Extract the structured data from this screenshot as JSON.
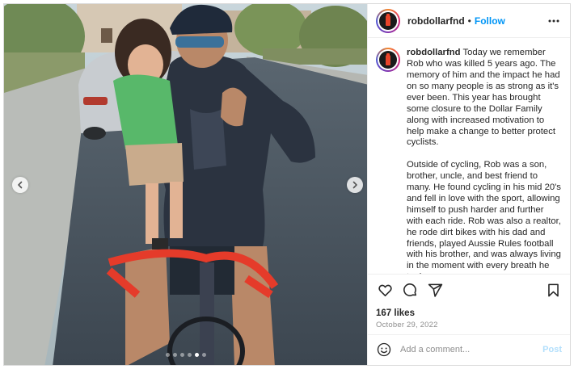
{
  "post": {
    "photo": {
      "slide_count": 6,
      "active_slide_index": 4
    },
    "header": {
      "username": "robdollarfnd",
      "separator": "•",
      "follow_label": "Follow",
      "more_icon": "more-horizontal-icon"
    },
    "caption": {
      "username": "robdollarfnd",
      "paragraph_1": "Today we remember Rob who was killed 5 years ago. The memory of him and the impact he had on so many people is as strong as it's ever been. This year has brought some closure to the Dollar Family along with increased motivation to help make a change to better protect cyclists.",
      "paragraph_2": "Outside of cycling, Rob was a son, brother, uncle, and best friend to many. He found cycling in his mid 20's and fell in love with the sport, allowing himself to push harder and further with each ride. Rob was also a realtor, he rode dirt bikes with his dad and friends, played Aussie Rules football with his brother, and was always living in the moment with every breath he took."
    },
    "actions": {
      "like_icon": "heart-icon",
      "comment_icon": "comment-icon",
      "share_icon": "share-icon",
      "save_icon": "bookmark-icon",
      "likes_text": "167 likes",
      "date_text": "October 29, 2022"
    },
    "comment_box": {
      "emoji_icon": "emoji-icon",
      "placeholder": "Add a comment...",
      "post_label": "Post"
    },
    "colors": {
      "follow_blue": "#0095f6",
      "post_disabled": "#b2dffc",
      "muted_text": "#8e8e8e"
    }
  }
}
